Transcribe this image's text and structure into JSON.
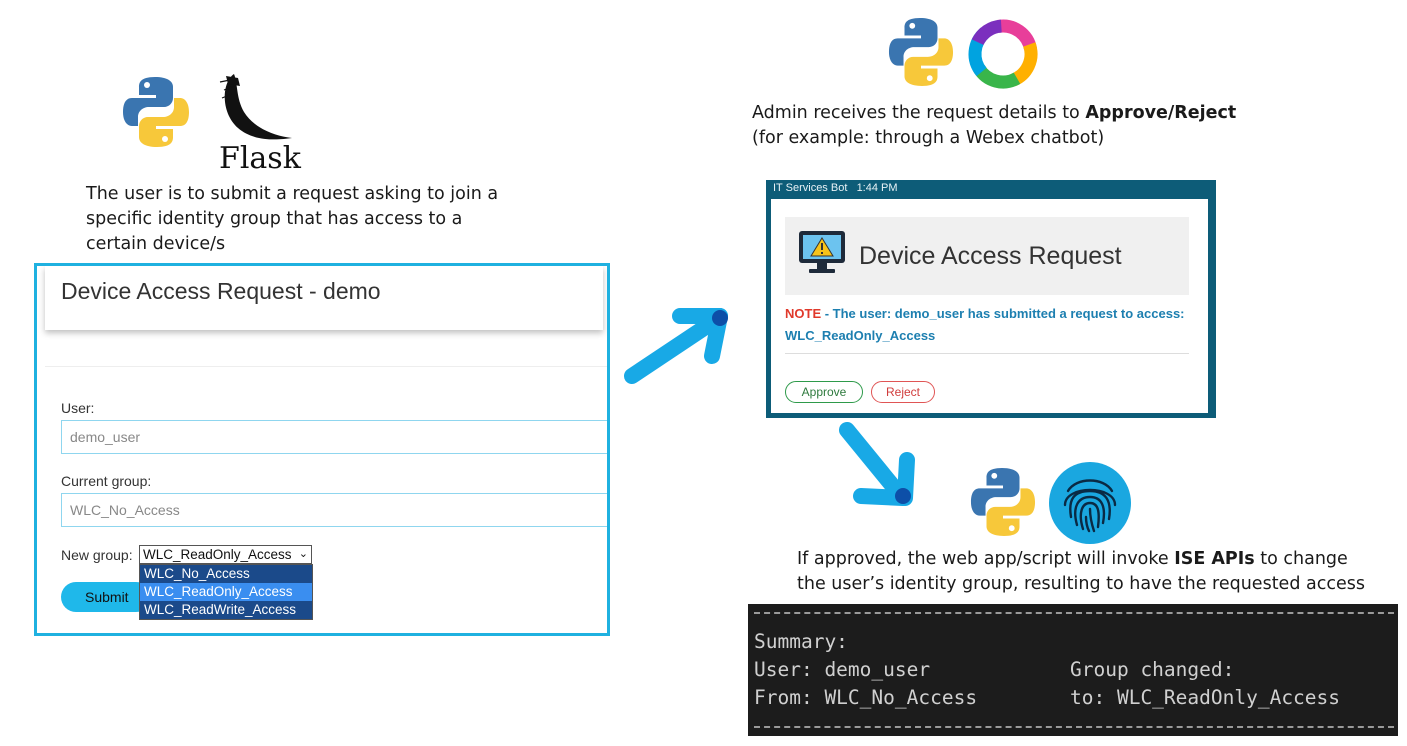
{
  "left": {
    "flask_logo_text": "Flask",
    "caption_lines": [
      "The user is to submit a request asking to join a",
      "specific identity group that has access to a",
      "certain device/s"
    ]
  },
  "flask_app": {
    "title": "Device Access Request - demo",
    "user_label": "User:",
    "user_value": "demo_user",
    "current_group_label": "Current group:",
    "current_group_value": "WLC_No_Access",
    "new_group_label": "New group:",
    "new_group_selected": "WLC_ReadOnly_Access",
    "new_group_options": [
      "WLC_No_Access",
      "WLC_ReadOnly_Access",
      "WLC_ReadWrite_Access"
    ],
    "submit_label": "Submit"
  },
  "admin": {
    "caption_line1_prefix": "Admin receives the request details to ",
    "caption_line1_bold": "Approve/Reject",
    "caption_line2": "(for example: through a Webex chatbot)"
  },
  "webex_card": {
    "bot_name": "IT Services Bot",
    "time": "1:44 PM",
    "title": "Device Access Request",
    "note_label": "NOTE",
    "note_text": " - The user: demo_user has submitted a request to access:",
    "requested_group": "WLC_ReadOnly_Access",
    "approve_label": "Approve",
    "reject_label": "Reject"
  },
  "ise": {
    "caption_line1_prefix": "If approved, the web app/script will invoke ",
    "caption_line1_bold": "ISE APIs",
    "caption_line1_suffix": " to change",
    "caption_line2": "the user’s identity group, resulting to have the requested access"
  },
  "terminal": {
    "summary": "Summary:",
    "user_line": "User: demo_user",
    "from_line": "From: WLC_No_Access",
    "group_changed": "Group changed:",
    "to_line": "to: WLC_ReadOnly_Access"
  },
  "colors": {
    "accent_cyan": "#1fb1e0",
    "arrow_blue": "#18a9e6",
    "webex_frame": "#0d5c78",
    "python_blue": "#3a75b0",
    "python_yellow": "#f7c83a"
  }
}
